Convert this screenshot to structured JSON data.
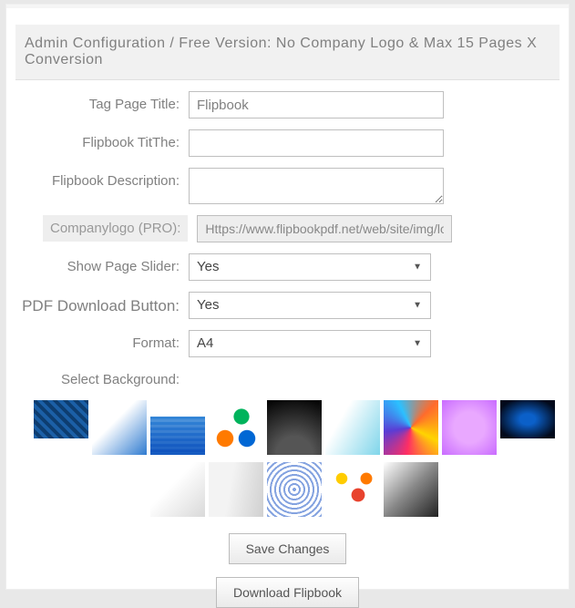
{
  "banner": "Admin Configuration / Free Version: No Company Logo & Max 15 Pages X Conversion",
  "fields": {
    "tag_page_title": {
      "label": "Tag Page Title:",
      "value": "Flipbook"
    },
    "flipbook_title": {
      "label": "Flipbook TitThe:",
      "value": ""
    },
    "flipbook_description": {
      "label": "Flipbook Description:",
      "value": ""
    },
    "company_logo": {
      "label": "Companylogo (PRO):",
      "value": "Https://www.flipbookpdf.net/web/site/img/logo"
    },
    "show_page_slider": {
      "label": "Show Page Slider:",
      "value": "Yes"
    },
    "pdf_download_button": {
      "label": "PDF Download Button:",
      "value": "Yes"
    },
    "format": {
      "label": "Format:",
      "value": "A4"
    },
    "select_background": {
      "label": "Select Background:"
    }
  },
  "buttons": {
    "save": "Save Changes",
    "download": "Download Flipbook"
  }
}
